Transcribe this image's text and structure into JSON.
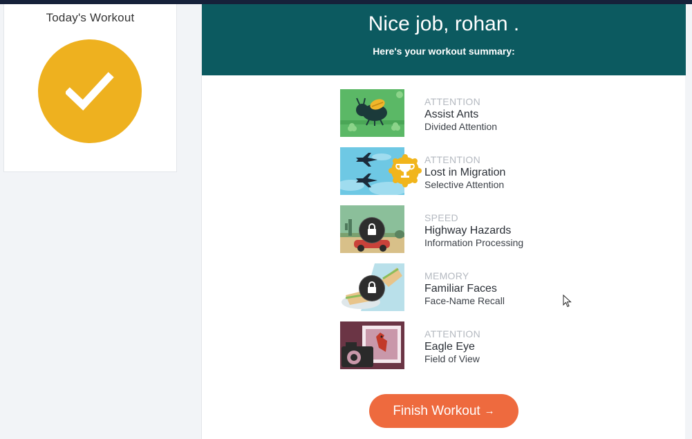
{
  "today": {
    "title": "Today's Workout",
    "icon": "checkmark-icon",
    "color": "#eeb11f"
  },
  "header": {
    "title": "Nice job, rohan .",
    "subtitle": "Here's your workout summary:",
    "background": "#0c5a60"
  },
  "games": [
    {
      "category": "ATTENTION",
      "name": "Assist Ants",
      "subtitle": "Divided Attention",
      "status": "completed"
    },
    {
      "category": "ATTENTION",
      "name": "Lost in Migration",
      "subtitle": "Selective Attention",
      "status": "trophy"
    },
    {
      "category": "SPEED",
      "name": "Highway Hazards",
      "subtitle": "Information Processing",
      "status": "locked"
    },
    {
      "category": "MEMORY",
      "name": "Familiar Faces",
      "subtitle": "Face-Name Recall",
      "status": "locked"
    },
    {
      "category": "ATTENTION",
      "name": "Eagle Eye",
      "subtitle": "Field of View",
      "status": "completed"
    }
  ],
  "finish_button": {
    "label": "Finish Workout",
    "arrow": "→",
    "color": "#ee6a3e"
  }
}
